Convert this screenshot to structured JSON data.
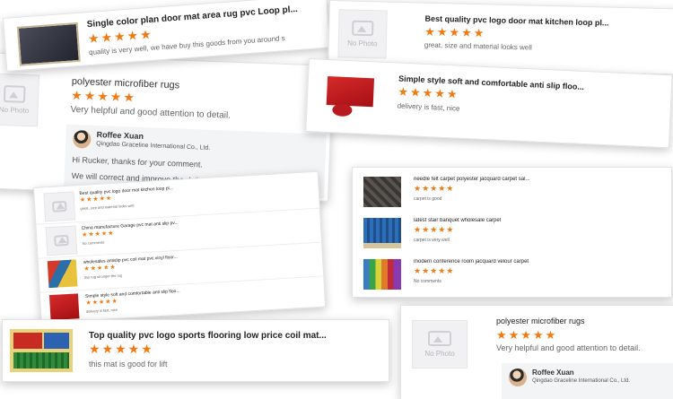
{
  "reviews": {
    "single_color": {
      "title": "Single color plan door mat area rug pvc Loop pl...",
      "stars": "★★★★★",
      "comment": "quality is very well, we have buy this goods from you around s"
    },
    "best_quality": {
      "title": "Best quality pvc logo door mat kitchen loop pl...",
      "stars": "★★★★★",
      "comment": "great, size and material looks well",
      "no_photo": "No Photo"
    },
    "microfiber_top": {
      "title": "polyester microfiber rugs",
      "stars": "★★★★★",
      "comment": "Very helpful and good attention to detail.",
      "no_photo": "No Photo",
      "reply": {
        "name": "Roffee Xuan",
        "company": "Qingdao Graceline International Co., Ltd.",
        "line1": "Hi Rucker, thanks for your comment.",
        "line2": "We will correct and improve the delivery time"
      }
    },
    "simple_style": {
      "title": "Simple style soft and comfortable anti slip floo...",
      "stars": "★★★★★",
      "comment": "delivery is fast, nice"
    },
    "list_left": [
      {
        "title": "Best quality pvc logo door mat kitchen loop pl...",
        "stars": "★★★★★",
        "comment": "great, size and material looks well",
        "no_photo": "No Photo"
      },
      {
        "title": "China manufacture Garage pvc mat anti slip pv...",
        "stars": "★★★★★",
        "comment": "No comments",
        "no_photo": "No Photo"
      },
      {
        "title": "wholesales antislip pvc coil mat pvc vinyl floor...",
        "stars": "★★★★★",
        "comment": "this rug stronger the rug"
      },
      {
        "title": "Simple style soft and comfortable anti slip floo...",
        "stars": "★★★★★",
        "comment": "delivery is fast, nice"
      }
    ],
    "list_right": [
      {
        "title": "needle felt carpet polyester jacquard carpet sal...",
        "stars": "★★★★★",
        "comment": "carpet is good"
      },
      {
        "title": "latest stair banquet wholesale carpet",
        "stars": "★★★★★",
        "comment": "carpet is very well"
      },
      {
        "title": "modern conference room jacquard velour carpet",
        "stars": "★★★★★",
        "comment": "No comments"
      }
    ],
    "top_quality": {
      "title": "Top quality pvc logo sports flooring low price coil mat...",
      "stars": "★★★★★",
      "comment": "this mat is good for lift"
    },
    "microfiber_bottom": {
      "title": "polyester microfiber rugs",
      "stars": "★★★★★",
      "comment": "Very helpful and good attention to detail.",
      "no_photo": "No Photo",
      "reply": {
        "name": "Roffee Xuan",
        "company": "Qingdao Graceline International Co., Ltd."
      }
    }
  },
  "colors": {
    "star": "#f07a13",
    "text": "#333333",
    "muted": "#666666",
    "reply_bg": "#f3f4f6"
  }
}
